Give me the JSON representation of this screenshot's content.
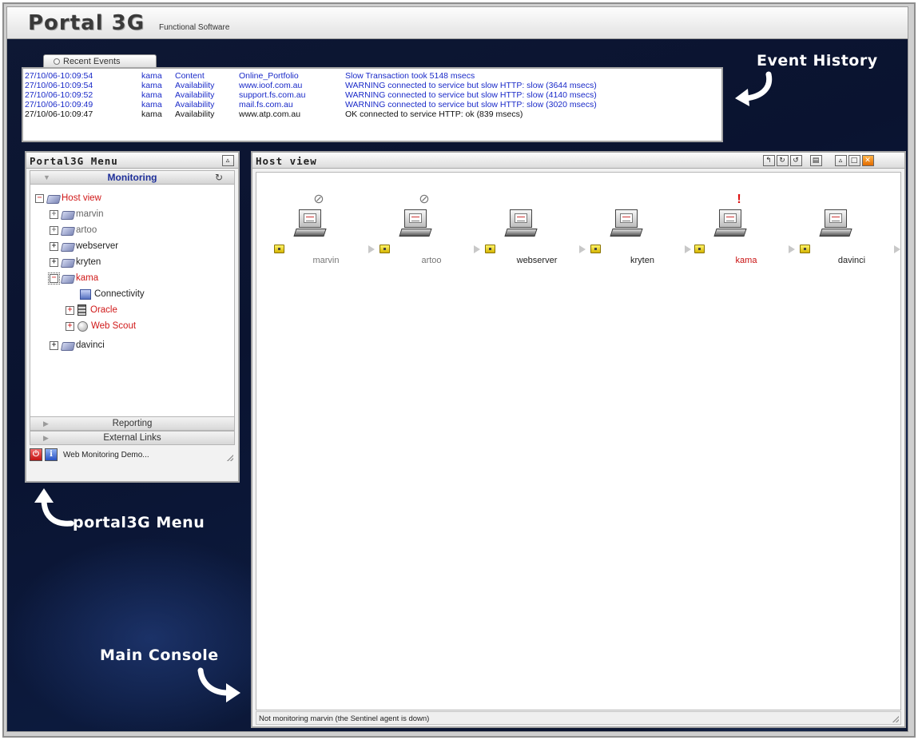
{
  "app": {
    "brand": "Portal 3G",
    "brand_sub": "Functional Software"
  },
  "events": {
    "tab_label": "Recent Events",
    "rows": [
      {
        "time": "27/10/06-10:09:54",
        "user": "kama",
        "type": "Content",
        "service": "Online_Portfolio",
        "message": "Slow Transaction took 5148 msecs",
        "level": "warn"
      },
      {
        "time": "27/10/06-10:09:54",
        "user": "kama",
        "type": "Availability",
        "service": "www.ioof.com.au",
        "message": "WARNING connected to service but slow HTTP: slow (3644 msecs)",
        "level": "warn"
      },
      {
        "time": "27/10/06-10:09:52",
        "user": "kama",
        "type": "Availability",
        "service": "support.fs.com.au",
        "message": "WARNING connected to service but slow HTTP: slow (4140 msecs)",
        "level": "warn"
      },
      {
        "time": "27/10/06-10:09:49",
        "user": "kama",
        "type": "Availability",
        "service": "mail.fs.com.au",
        "message": "WARNING connected to service but slow HTTP: slow (3020 msecs)",
        "level": "warn"
      },
      {
        "time": "27/10/06-10:09:47",
        "user": "kama",
        "type": "Availability",
        "service": "www.atp.com.au",
        "message": "OK connected to service HTTP: ok (839 msecs)",
        "level": "ok"
      }
    ]
  },
  "callouts": {
    "event_history": "Event History",
    "portal_menu": "portal3G Menu",
    "main_console": "Main Console"
  },
  "menu": {
    "title": "Portal3G Menu",
    "section_monitoring": "Monitoring",
    "tree": {
      "root": "Host view",
      "marvin": "marvin",
      "artoo": "artoo",
      "webserver": "webserver",
      "kryten": "kryten",
      "kama": "kama",
      "connectivity": "Connectivity",
      "oracle": "Oracle",
      "web_scout": "Web Scout",
      "davinci": "davinci"
    },
    "section_reporting": "Reporting",
    "section_external": "External Links",
    "status_text": "Web Monitoring Demo..."
  },
  "hostview": {
    "title": "Host view",
    "status_text": "Not monitoring marvin (the Sentinel agent is down)",
    "hosts": [
      {
        "name": "marvin",
        "alert": "disabled",
        "label_color": "grey"
      },
      {
        "name": "artoo",
        "alert": "disabled",
        "label_color": "grey"
      },
      {
        "name": "webserver",
        "alert": "none",
        "label_color": "normal"
      },
      {
        "name": "kryten",
        "alert": "none",
        "label_color": "normal"
      },
      {
        "name": "kama",
        "alert": "error",
        "label_color": "red"
      },
      {
        "name": "davinci",
        "alert": "none",
        "label_color": "normal"
      }
    ]
  },
  "icons": {
    "disabled": "prohibited-icon",
    "error": "exclamation-icon"
  },
  "colors": {
    "warning_text": "#1a2ac8",
    "alert_red": "#d01818",
    "monitoring_header": "#1e2f9a"
  }
}
